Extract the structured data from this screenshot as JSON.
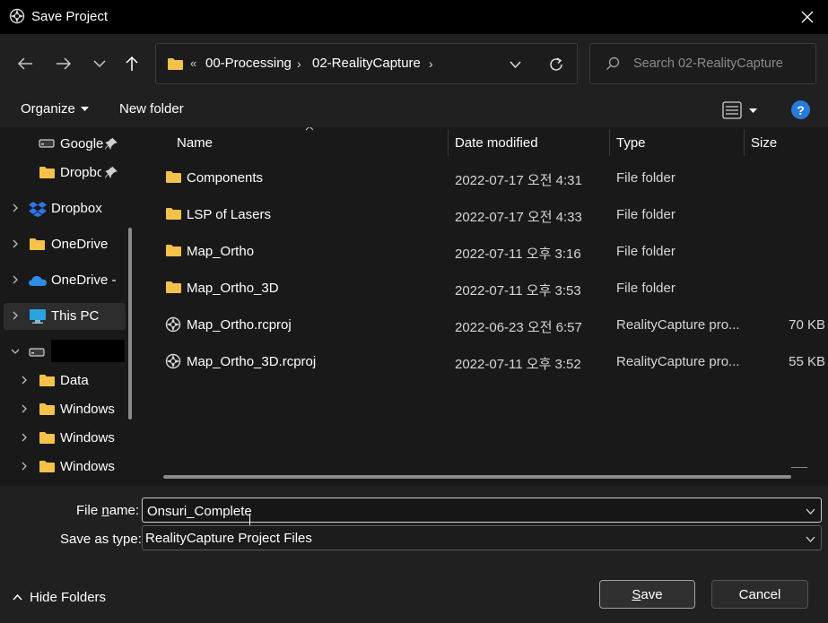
{
  "window": {
    "title": "Save Project"
  },
  "address": {
    "overflow_marker": "«",
    "crumbs": [
      "00-Processing",
      "02-RealityCapture"
    ],
    "separator": "›"
  },
  "search": {
    "placeholder": "Search 02-RealityCapture"
  },
  "toolbar": {
    "organize_label": "Organize",
    "new_folder_label": "New folder",
    "help_label": "?"
  },
  "nav": {
    "items": [
      {
        "label": "Google",
        "pinned": true
      },
      {
        "label": "Dropbox",
        "pinned": true
      },
      {
        "label": "Dropbox"
      },
      {
        "label": "OneDrive"
      },
      {
        "label": "OneDrive -"
      },
      {
        "label": "This PC",
        "selected": true
      },
      {
        "label": ""
      },
      {
        "label": "Data"
      },
      {
        "label": "Windows"
      },
      {
        "label": "Windows"
      },
      {
        "label": "Windows"
      }
    ]
  },
  "columns": {
    "name": "Name",
    "date": "Date modified",
    "type": "Type",
    "size": "Size"
  },
  "files": [
    {
      "name": "Components",
      "date": "2022-07-17 오전 4:31",
      "type": "File folder",
      "size": "",
      "icon": "folder-icon"
    },
    {
      "name": "LSP of Lasers",
      "date": "2022-07-17 오전 4:33",
      "type": "File folder",
      "size": "",
      "icon": "folder-icon"
    },
    {
      "name": "Map_Ortho",
      "date": "2022-07-11 오후 3:16",
      "type": "File folder",
      "size": "",
      "icon": "folder-icon"
    },
    {
      "name": "Map_Ortho_3D",
      "date": "2022-07-11 오후 3:53",
      "type": "File folder",
      "size": "",
      "icon": "folder-icon"
    },
    {
      "name": "Map_Ortho.rcproj",
      "date": "2022-06-23 오전 6:57",
      "type": "RealityCapture pro...",
      "size": "70 KB",
      "icon": "realitycapture-file-icon"
    },
    {
      "name": "Map_Ortho_3D.rcproj",
      "date": "2022-07-11 오후 3:52",
      "type": "RealityCapture pro...",
      "size": "55 KB",
      "icon": "realitycapture-file-icon"
    }
  ],
  "form": {
    "file_name_label_pre": "File ",
    "file_name_label_u": "n",
    "file_name_label_post": "ame:",
    "file_name_value": "Onsuri_Complete",
    "save_type_label": "Save as type:",
    "save_type_value": "RealityCapture Project Files"
  },
  "footer": {
    "hide_folders_label": "Hide Folders",
    "save_u": "S",
    "save_rest": "ave",
    "cancel_label": "Cancel"
  },
  "colors": {
    "accent": "#2979d9",
    "folder": "#f4c24a",
    "background": "#191919"
  }
}
